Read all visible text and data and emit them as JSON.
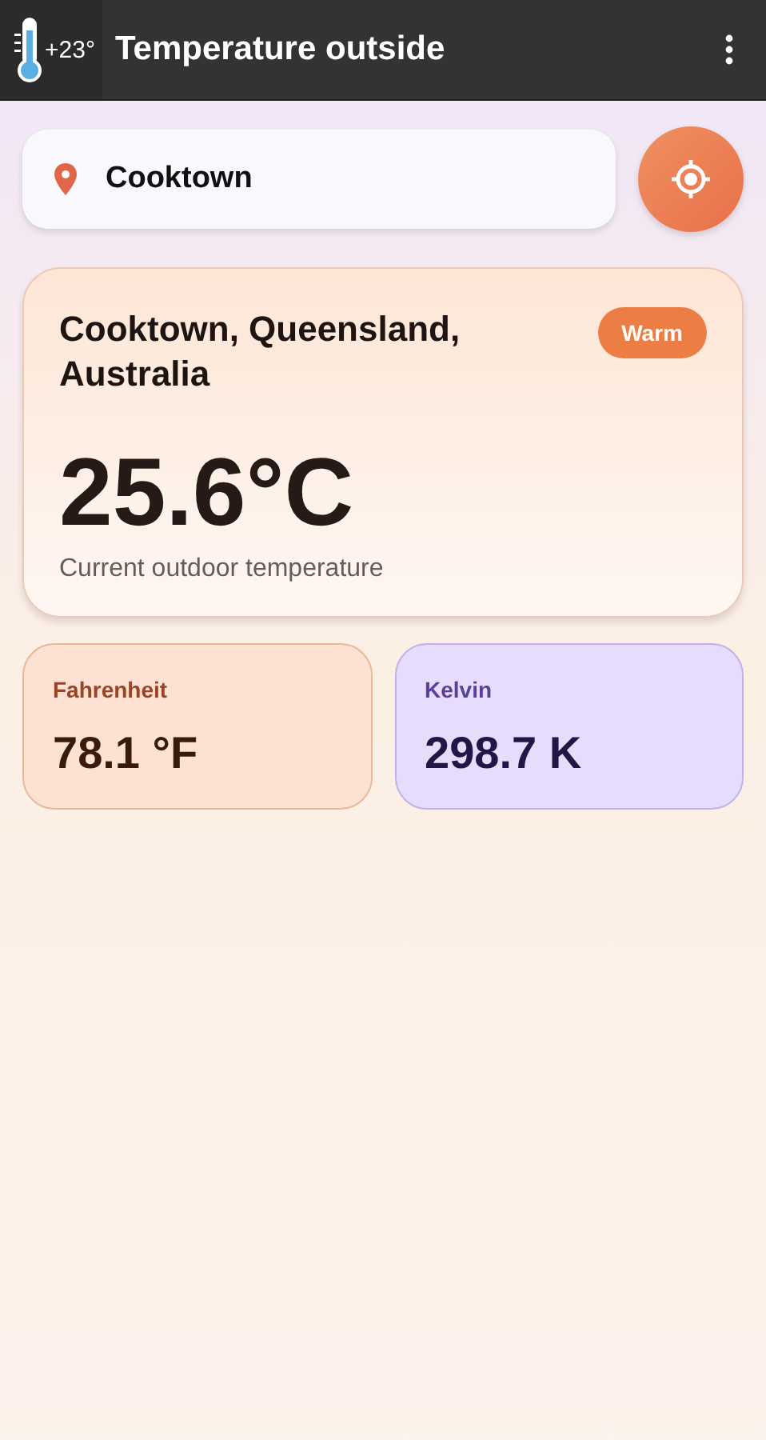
{
  "app_bar": {
    "icon_text": "+23°",
    "title": "Temperature outside"
  },
  "search": {
    "value": "Cooktown"
  },
  "current": {
    "location": "Cooktown, Queensland, Australia",
    "badge": "Warm",
    "temperature": "25.6°C",
    "caption": "Current outdoor temperature"
  },
  "units": [
    {
      "kind": "fahrenheit",
      "label": "Fahrenheit",
      "value": "78.1 °F"
    },
    {
      "kind": "kelvin",
      "label": "Kelvin",
      "value": "298.7 K"
    }
  ]
}
